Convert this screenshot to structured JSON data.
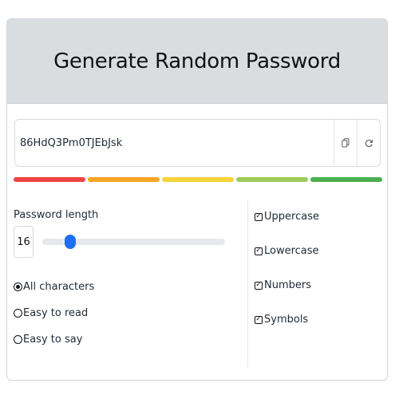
{
  "header": {
    "title": "Generate Random Password"
  },
  "password": {
    "value": "86HdQ3Pm0TJEbJsk",
    "copy_icon": "copy-icon",
    "refresh_icon": "refresh-icon"
  },
  "strength": {
    "segments": [
      {
        "color": "#ef4444"
      },
      {
        "color": "#f5a623"
      },
      {
        "color": "#f6d33a"
      },
      {
        "color": "#9ccc5a"
      },
      {
        "color": "#4caf50"
      }
    ]
  },
  "length": {
    "label": "Password length",
    "value": "16",
    "slider_fraction": 0.13
  },
  "character_modes": [
    {
      "label": "All characters",
      "checked": true
    },
    {
      "label": "Easy to read",
      "checked": false
    },
    {
      "label": "Easy to say",
      "checked": false
    }
  ],
  "character_sets": [
    {
      "label": "Uppercase",
      "checked": true
    },
    {
      "label": "Lowercase",
      "checked": true
    },
    {
      "label": "Numbers",
      "checked": true
    },
    {
      "label": "Symbols",
      "checked": true
    }
  ],
  "colors": {
    "accent": "#1d6ff0",
    "header_bg": "#dadde0"
  }
}
